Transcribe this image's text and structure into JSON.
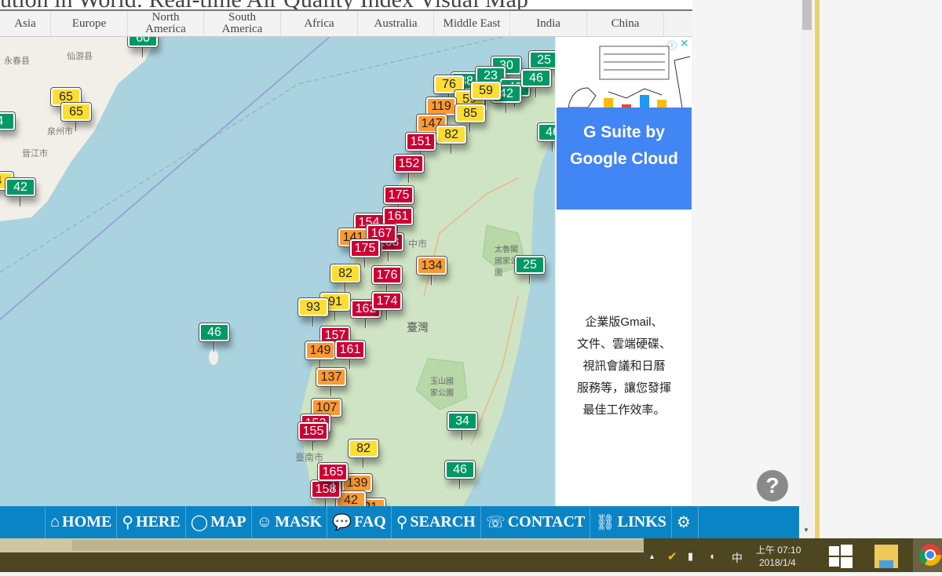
{
  "title": "ution in World: Real-time Air Quality Index Visual Map",
  "tabs": [
    "Asia",
    "Europe",
    "North America",
    "South America",
    "Africa",
    "Australia",
    "Middle East",
    "India",
    "China"
  ],
  "aqi_colors": {
    "good": "#009966",
    "moderate": "#ffde33",
    "sensitive": "#ff9933",
    "unhealthy": "#cc0033"
  },
  "map_labels": [
    "臺灣",
    "太魯閣國家公園",
    "玉山國家公園",
    "臺南市",
    "中市",
    "泉州市",
    "晉江市",
    "永春县",
    "仙游县"
  ],
  "markers": [
    {
      "v": "60",
      "c": "good"
    },
    {
      "v": "65",
      "c": "moderate"
    },
    {
      "v": "65",
      "c": "moderate"
    },
    {
      "v": "4",
      "c": "good"
    },
    {
      "v": "4",
      "c": "moderate"
    },
    {
      "v": "42",
      "c": "good"
    },
    {
      "v": "46",
      "c": "good"
    },
    {
      "v": "30",
      "c": "good"
    },
    {
      "v": "38",
      "c": "good"
    },
    {
      "v": "23",
      "c": "good"
    },
    {
      "v": "25",
      "c": "good"
    },
    {
      "v": "40",
      "c": "good"
    },
    {
      "v": "42",
      "c": "good"
    },
    {
      "v": "46",
      "c": "good"
    },
    {
      "v": "76",
      "c": "moderate"
    },
    {
      "v": "59",
      "c": "moderate"
    },
    {
      "v": "59",
      "c": "moderate"
    },
    {
      "v": "119",
      "c": "sensitive"
    },
    {
      "v": "85",
      "c": "moderate"
    },
    {
      "v": "147",
      "c": "sensitive"
    },
    {
      "v": "82",
      "c": "moderate"
    },
    {
      "v": "151",
      "c": "unhealthy"
    },
    {
      "v": "152",
      "c": "unhealthy"
    },
    {
      "v": "46",
      "c": "good"
    },
    {
      "v": "175",
      "c": "unhealthy"
    },
    {
      "v": "154",
      "c": "unhealthy"
    },
    {
      "v": "161",
      "c": "unhealthy"
    },
    {
      "v": "141",
      "c": "sensitive"
    },
    {
      "v": "163",
      "c": "unhealthy"
    },
    {
      "v": "167",
      "c": "unhealthy"
    },
    {
      "v": "175",
      "c": "unhealthy"
    },
    {
      "v": "82",
      "c": "moderate"
    },
    {
      "v": "134",
      "c": "sensitive"
    },
    {
      "v": "25",
      "c": "good"
    },
    {
      "v": "176",
      "c": "unhealthy"
    },
    {
      "v": "91",
      "c": "moderate"
    },
    {
      "v": "93",
      "c": "moderate"
    },
    {
      "v": "162",
      "c": "unhealthy"
    },
    {
      "v": "174",
      "c": "unhealthy"
    },
    {
      "v": "157",
      "c": "unhealthy"
    },
    {
      "v": "149",
      "c": "sensitive"
    },
    {
      "v": "161",
      "c": "unhealthy"
    },
    {
      "v": "137",
      "c": "sensitive"
    },
    {
      "v": "107",
      "c": "sensitive"
    },
    {
      "v": "153",
      "c": "unhealthy"
    },
    {
      "v": "155",
      "c": "unhealthy"
    },
    {
      "v": "82",
      "c": "moderate"
    },
    {
      "v": "34",
      "c": "good"
    },
    {
      "v": "46",
      "c": "good"
    },
    {
      "v": "139",
      "c": "sensitive"
    },
    {
      "v": "21",
      "c": "sensitive"
    },
    {
      "v": "42",
      "c": "sensitive"
    },
    {
      "v": "158",
      "c": "unhealthy"
    },
    {
      "v": "165",
      "c": "unhealthy"
    }
  ],
  "ad": {
    "headline": "G Suite by Google Cloud",
    "body": [
      "企業版Gmail、",
      "文件、雲端硬碟、",
      "視訊會議和日曆",
      "服務等，讓您發揮",
      "最佳工作效率。"
    ]
  },
  "help": "?",
  "nav": [
    {
      "label": "HOME",
      "icon": "home-icon"
    },
    {
      "label": "HERE",
      "icon": "location-pin-icon"
    },
    {
      "label": "MAP",
      "icon": "globe-icon"
    },
    {
      "label": "MASK",
      "icon": "mask-icon"
    },
    {
      "label": "FAQ",
      "icon": "faq-bubble-icon"
    },
    {
      "label": "SEARCH",
      "icon": "search-icon"
    },
    {
      "label": "CONTACT",
      "icon": "contact-icon"
    },
    {
      "label": "LINKS",
      "icon": "link-icon"
    },
    {
      "label": "",
      "icon": "gear-icon"
    }
  ],
  "taskbar": {
    "time": "上午 07:10",
    "date": "2018/1/4",
    "ime": "中"
  }
}
